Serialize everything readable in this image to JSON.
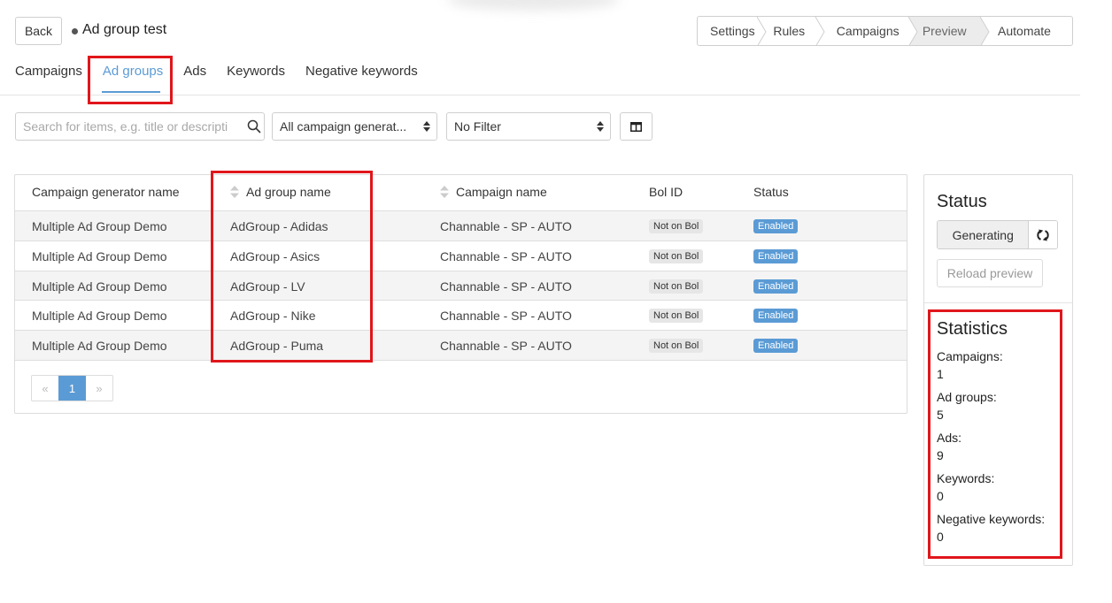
{
  "header": {
    "back_label": "Back",
    "title": "Ad group test"
  },
  "steps": [
    {
      "label": "Settings",
      "active": false
    },
    {
      "label": "Rules",
      "active": false
    },
    {
      "label": "Campaigns",
      "active": false
    },
    {
      "label": "Preview",
      "active": true
    },
    {
      "label": "Automate",
      "active": false
    }
  ],
  "tabs": [
    {
      "label": "Campaigns",
      "active": false
    },
    {
      "label": "Ad groups",
      "active": true
    },
    {
      "label": "Ads",
      "active": false
    },
    {
      "label": "Keywords",
      "active": false
    },
    {
      "label": "Negative keywords",
      "active": false
    }
  ],
  "filters": {
    "search_placeholder": "Search for items, e.g. title or descripti",
    "generator_select": "All campaign generat...",
    "filter_select": "No Filter",
    "search_icon": "search-icon",
    "columns_icon": "columns-icon"
  },
  "table": {
    "headers": [
      "Campaign generator name",
      "Ad group name",
      "Campaign name",
      "Bol ID",
      "Status"
    ],
    "rows": [
      {
        "generator": "Multiple Ad Group Demo",
        "ad_group": "AdGroup - Adidas",
        "campaign": "Channable - SP - AUTO",
        "bol_id": "Not on Bol",
        "status": "Enabled"
      },
      {
        "generator": "Multiple Ad Group Demo",
        "ad_group": "AdGroup - Asics",
        "campaign": "Channable - SP - AUTO",
        "bol_id": "Not on Bol",
        "status": "Enabled"
      },
      {
        "generator": "Multiple Ad Group Demo",
        "ad_group": "AdGroup - LV",
        "campaign": "Channable - SP - AUTO",
        "bol_id": "Not on Bol",
        "status": "Enabled"
      },
      {
        "generator": "Multiple Ad Group Demo",
        "ad_group": "AdGroup - Nike",
        "campaign": "Channable - SP - AUTO",
        "bol_id": "Not on Bol",
        "status": "Enabled"
      },
      {
        "generator": "Multiple Ad Group Demo",
        "ad_group": "AdGroup - Puma",
        "campaign": "Channable - SP - AUTO",
        "bol_id": "Not on Bol",
        "status": "Enabled"
      }
    ]
  },
  "pagination": {
    "prev": "«",
    "current": "1",
    "next": "»"
  },
  "status_panel": {
    "heading": "Status",
    "generating_label": "Generating",
    "refresh_icon": "refresh-icon",
    "reload_label": "Reload preview"
  },
  "statistics": {
    "heading": "Statistics",
    "items": [
      {
        "label": "Campaigns:",
        "value": "1"
      },
      {
        "label": "Ad groups:",
        "value": "5"
      },
      {
        "label": "Ads:",
        "value": "9"
      },
      {
        "label": "Keywords:",
        "value": "0"
      },
      {
        "label": "Negative keywords:",
        "value": "0"
      }
    ]
  },
  "colors": {
    "accent": "#5b9bd5",
    "highlight": "#e0161b",
    "badge_gray": "#e6e6e6",
    "row_stripe": "#f4f4f4"
  }
}
